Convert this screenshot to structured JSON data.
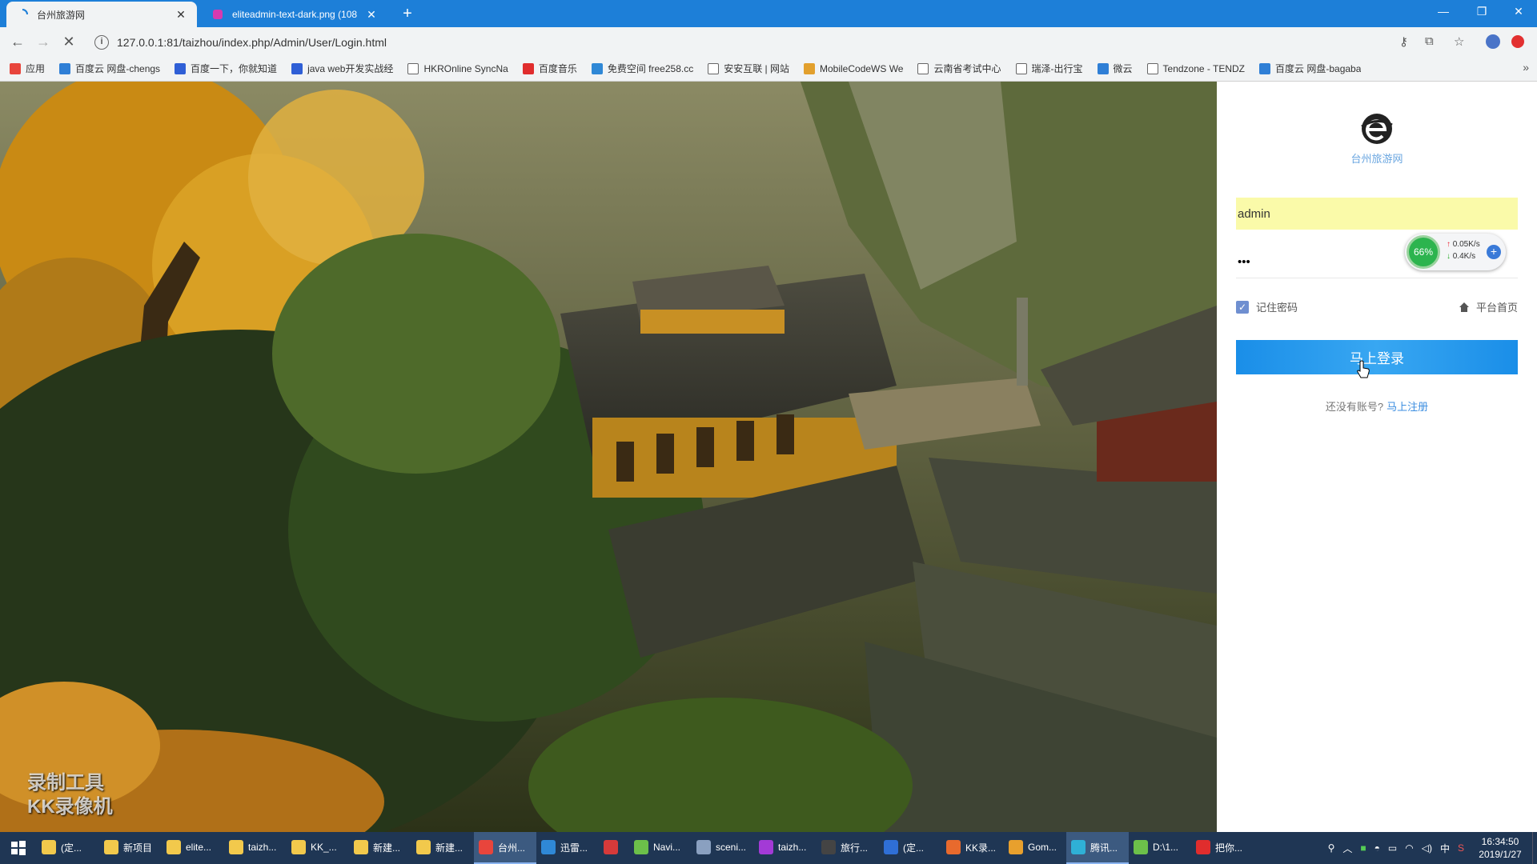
{
  "browser": {
    "tabs": [
      {
        "title": "台州旅游网",
        "active": true
      },
      {
        "title": "eliteadmin-text-dark.png (108",
        "active": false
      }
    ],
    "new_tab": "+",
    "window_controls": {
      "minimize": "—",
      "restore": "❐",
      "close": "✕"
    },
    "url": "127.0.0.1:81/taizhou/index.php/Admin/User/Login.html",
    "bookmarks": [
      {
        "label": "应用",
        "icon": "apps-grid-icon",
        "color": "#e8453c"
      },
      {
        "label": "百度云 网盘-chengs",
        "icon": "baidu-cloud-icon",
        "color": "#2f7fd6"
      },
      {
        "label": "百度一下，你就知道",
        "icon": "baidu-paw-icon",
        "color": "#2f5fd6"
      },
      {
        "label": "java web开发实战经",
        "icon": "baidu-paw-icon",
        "color": "#2f5fd6"
      },
      {
        "label": "HKROnline SyncNa",
        "icon": "page-icon",
        "color": "#ffffff"
      },
      {
        "label": "百度音乐",
        "icon": "baidu-music-icon",
        "color": "#e02d2d"
      },
      {
        "label": "免费空间 free258.cc",
        "icon": "free258-icon",
        "color": "#2f88d6"
      },
      {
        "label": "安安互联 | 网站",
        "icon": "page-icon",
        "color": "#ffffff"
      },
      {
        "label": "MobileCodeWS We",
        "icon": "webxml-icon",
        "color": "#e2a02d"
      },
      {
        "label": "云南省考试中心",
        "icon": "page-icon",
        "color": "#ffffff"
      },
      {
        "label": "瑞泽-出行宝",
        "icon": "page-icon",
        "color": "#ffffff"
      },
      {
        "label": "微云",
        "icon": "weiyun-icon",
        "color": "#2f7fd6"
      },
      {
        "label": "Tendzone - TENDZ",
        "icon": "page-icon",
        "color": "#ffffff"
      },
      {
        "label": "百度云 网盘-bagaba",
        "icon": "baidu-cloud-icon",
        "color": "#2f7fd6"
      }
    ]
  },
  "hero": {
    "watermark_line1": "录制工具",
    "watermark_line2": "KK录像机"
  },
  "login": {
    "brand": "台州旅游网",
    "username_value": "admin",
    "password_mask": "•••",
    "remember_label": "记住密码",
    "remember_checked": true,
    "home_link": "平台首页",
    "submit_label": "马上登录",
    "register_prompt": "还没有账号?",
    "register_link": "马上注册",
    "accent_color": "#1a8ee8"
  },
  "net_monitor": {
    "percent": "66%",
    "upload": "0.05K/s",
    "download": "0.4K/s"
  },
  "taskbar": {
    "items": [
      {
        "label": "(定...",
        "icon": "folder-icon",
        "color": "#f2c94c"
      },
      {
        "label": "新项目",
        "icon": "folder-icon",
        "color": "#f2c94c"
      },
      {
        "label": "elite...",
        "icon": "folder-icon",
        "color": "#f2c94c"
      },
      {
        "label": "taizh...",
        "icon": "folder-icon",
        "color": "#f2c94c"
      },
      {
        "label": "KK_...",
        "icon": "folder-icon",
        "color": "#f2c94c"
      },
      {
        "label": "新建...",
        "icon": "folder-icon",
        "color": "#f2c94c"
      },
      {
        "label": "新建...",
        "icon": "folder-icon",
        "color": "#f2c94c"
      },
      {
        "label": "台州...",
        "icon": "chrome-icon",
        "color": "#e8453c",
        "active": true
      },
      {
        "label": "迅雷...",
        "icon": "xunlei-icon",
        "color": "#2f88d6"
      },
      {
        "label": "",
        "icon": "shield-icon",
        "color": "#d63a3a"
      },
      {
        "label": "Navi...",
        "icon": "navicat-icon",
        "color": "#6cc04a"
      },
      {
        "label": "sceni...",
        "icon": "image-viewer-icon",
        "color": "#8aa0c0"
      },
      {
        "label": "taizh...",
        "icon": "phpstorm-icon",
        "color": "#a33ad6"
      },
      {
        "label": "旅行...",
        "icon": "code-editor-icon",
        "color": "#444444"
      },
      {
        "label": "(定...",
        "icon": "word-icon",
        "color": "#2f6fd6"
      },
      {
        "label": "KK录...",
        "icon": "kk-recorder-icon",
        "color": "#e86a2d"
      },
      {
        "label": "Gom...",
        "icon": "gom-player-icon",
        "color": "#e8a02d"
      },
      {
        "label": "腾讯...",
        "icon": "tencent-icon",
        "color": "#2fb0d6",
        "active": true
      },
      {
        "label": "D:\\1...",
        "icon": "notepad-icon",
        "color": "#6cc04a"
      },
      {
        "label": "把你...",
        "icon": "netease-music-icon",
        "color": "#e02d2d"
      }
    ],
    "tray": {
      "ime": "中",
      "time": "16:34:50",
      "date": "2019/1/27"
    }
  }
}
